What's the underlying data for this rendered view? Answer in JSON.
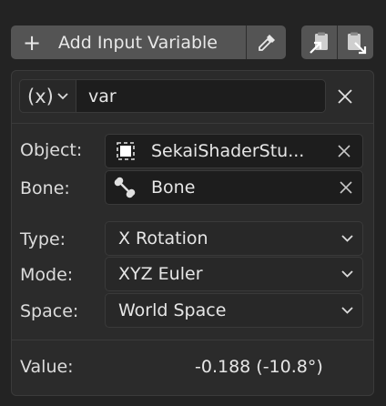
{
  "toolbar": {
    "add_label": "Add Input Variable",
    "add_icon": "plus-icon",
    "picker_icon": "eyedropper-icon",
    "copy_icon": "copy-variables-icon",
    "paste_icon": "paste-variables-icon"
  },
  "variable": {
    "type_glyph": "(x)",
    "name": "var"
  },
  "object": {
    "label": "Object:",
    "value": "SekaiShaderStu...",
    "icon": "object-icon"
  },
  "bone": {
    "label": "Bone:",
    "value": "Bone",
    "icon": "bone-icon"
  },
  "transform": {
    "type_label": "Type:",
    "type_value": "X Rotation",
    "mode_label": "Mode:",
    "mode_value": "XYZ Euler",
    "space_label": "Space:",
    "space_value": "World Space"
  },
  "value": {
    "label": "Value:",
    "text": "-0.188 (-10.8°)"
  }
}
